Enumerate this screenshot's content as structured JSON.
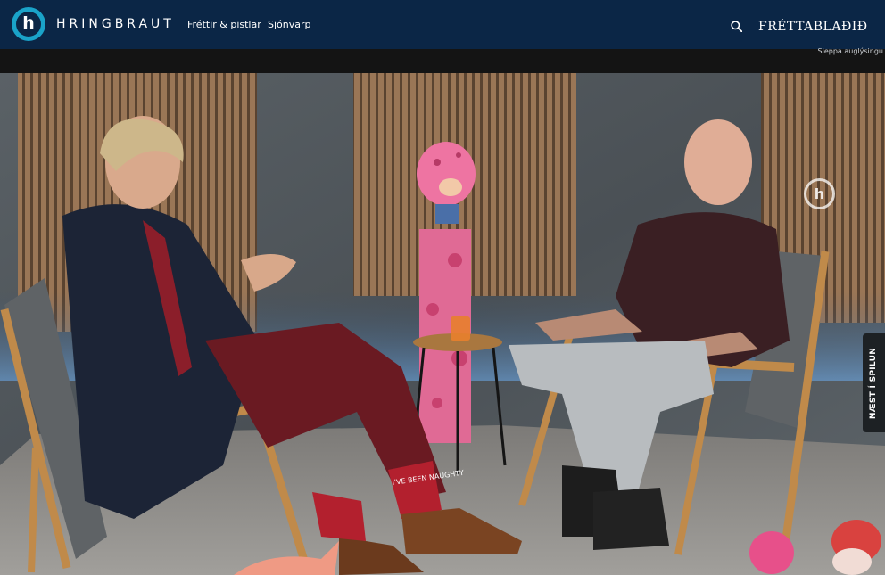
{
  "header": {
    "logo_letter": "h",
    "brand": "HRINGBRAUT",
    "nav": [
      {
        "label": "Fréttir & pistlar"
      },
      {
        "label": "Sjónvarp"
      }
    ],
    "search_icon": "search-icon",
    "partner": "FRÉTTABLAÐIÐ"
  },
  "ad": {
    "skip_label": "Sleppa auglýsingu"
  },
  "video": {
    "watermark_letter": "h",
    "next_label": "NÆST Í SPILUN",
    "sock_text": "I'VE BEEN NAUGHTY"
  },
  "colors": {
    "header_bg": "#0b2646",
    "logo_accent": "#1aa3c9",
    "wood_slats": "#8a6a4e",
    "pink": "#e9679a"
  }
}
